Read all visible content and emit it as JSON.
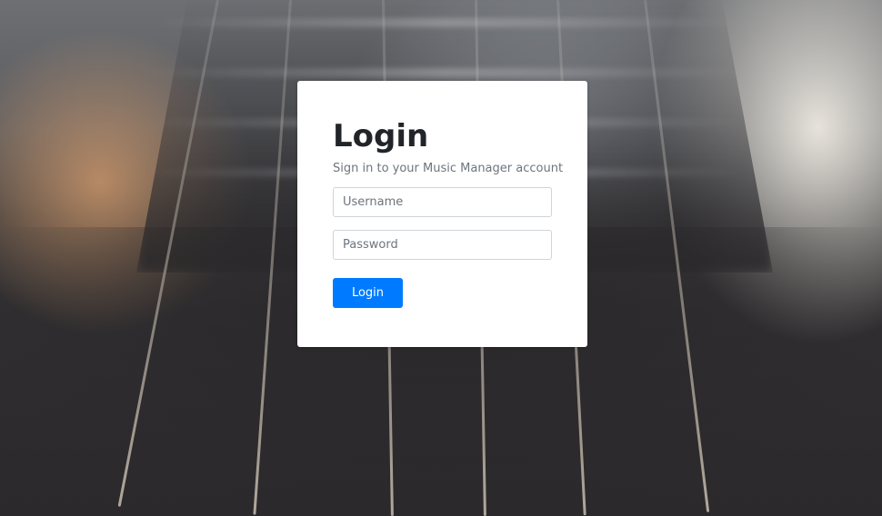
{
  "login": {
    "title": "Login",
    "subtitle": "Sign in to your Music Manager account",
    "username": {
      "placeholder": "Username",
      "value": ""
    },
    "password": {
      "placeholder": "Password",
      "value": ""
    },
    "submit_label": "Login"
  },
  "colors": {
    "accent": "#007bff",
    "card_background": "#ffffff",
    "title_text": "#212529",
    "muted_text": "#6c757d",
    "input_border": "#ced4da"
  },
  "background": {
    "description": "blurred close-up photo of guitar strings"
  }
}
